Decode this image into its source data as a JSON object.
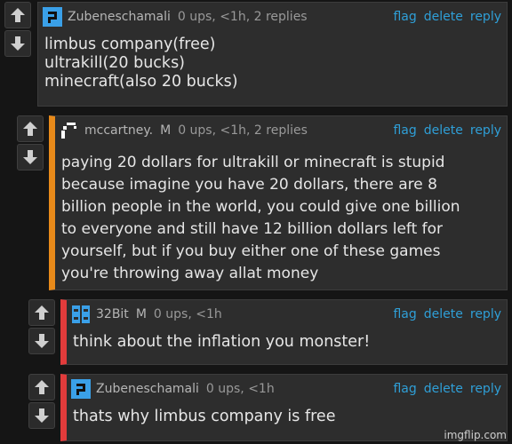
{
  "comments": [
    {
      "username": "Zubeneschamali",
      "meta": "0 ups, <1h, 2 replies",
      "actions": {
        "flag": "flag",
        "delete": "delete",
        "reply": "reply"
      },
      "lines": [
        "limbus company(free)",
        "ultrakill(20 bucks)",
        "minecraft(also 20 bucks)"
      ],
      "avatar_color": "#3aa0e8"
    },
    {
      "username": "mccartney.",
      "badge": "M",
      "meta": "0 ups, <1h, 2 replies",
      "actions": {
        "flag": "flag",
        "delete": "delete",
        "reply": "reply"
      },
      "lines": [
        "paying 20 dollars for ultrakill or minecraft is stupid",
        "because imagine you have 20 dollars, there are 8",
        "billion people in the world, you could give one billion",
        "to everyone and still have 12 billion dollars left for",
        "yourself, but if you buy either one of these games",
        "you're throwing away allat money"
      ],
      "bar_color": "#e88a1a"
    },
    {
      "username": "32Bit",
      "badge": "M",
      "meta": "0 ups, <1h",
      "actions": {
        "flag": "flag",
        "delete": "delete",
        "reply": "reply"
      },
      "lines": [
        "think about the inflation you monster!"
      ],
      "bar_color": "#e23b3b",
      "avatar_color": "#3aa0e8"
    },
    {
      "username": "Zubeneschamali",
      "meta": "0 ups, <1h",
      "actions": {
        "flag": "flag",
        "delete": "delete",
        "reply": "reply"
      },
      "lines": [
        "thats why limbus company is free"
      ],
      "bar_color": "#e23b3b",
      "avatar_color": "#3aa0e8"
    }
  ],
  "watermark": "imgflip.com",
  "icons": [
    "upvote-icon",
    "downvote-icon"
  ]
}
